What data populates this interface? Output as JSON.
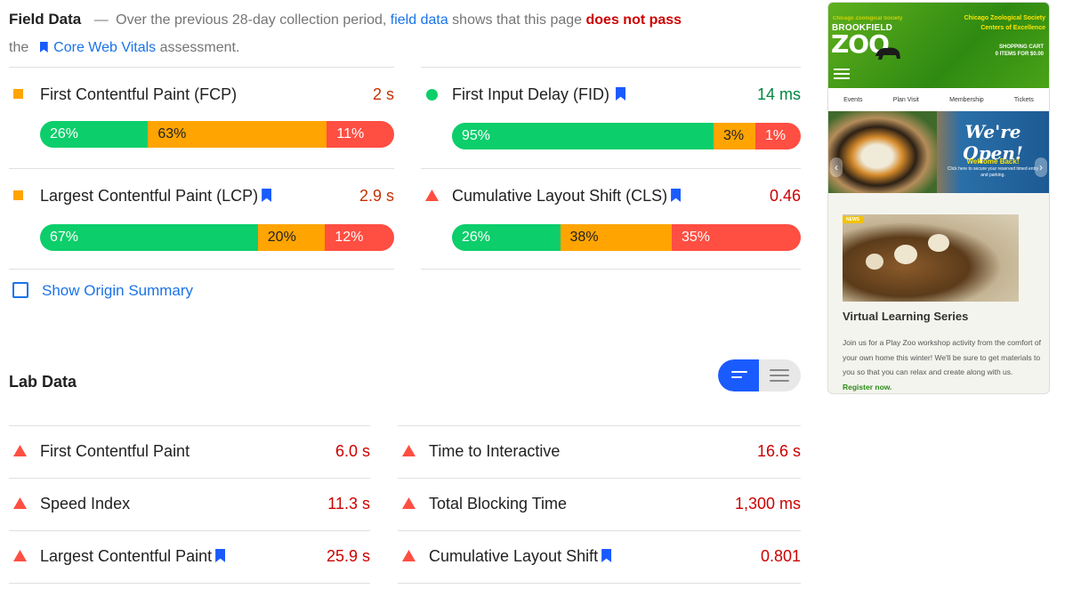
{
  "field": {
    "heading": "Field Data",
    "dash": "—",
    "intro_1": "Over the previous 28-day collection period,",
    "link_field_data": "field data",
    "intro_2": "shows that this page",
    "does_not_pass": "does not pass",
    "intro_3": "the",
    "link_cwv": "Core Web Vitals",
    "intro_4": "assessment.",
    "metrics": [
      {
        "title": "First Contentful Paint (FCP)",
        "value": "2 s",
        "rating": "average",
        "value_color": "#c33300",
        "bookmark": false,
        "bar": [
          {
            "label": "26%",
            "pct": 26
          },
          {
            "label": "63%",
            "pct": 63
          },
          {
            "label": "11%",
            "pct": 11
          }
        ]
      },
      {
        "title": "First Input Delay (FID)",
        "value": "14 ms",
        "rating": "good",
        "value_color": "#018642",
        "bookmark": true,
        "bar": [
          {
            "label": "95%",
            "pct": 95
          },
          {
            "label": "3%",
            "pct": 3
          },
          {
            "label": "1%",
            "pct": 1
          }
        ]
      },
      {
        "title": "Largest Contentful Paint (LCP)",
        "value": "2.9 s",
        "rating": "average",
        "value_color": "#c33300",
        "bookmark": true,
        "bar": [
          {
            "label": "67%",
            "pct": 67
          },
          {
            "label": "20%",
            "pct": 20
          },
          {
            "label": "12%",
            "pct": 12
          }
        ]
      },
      {
        "title": "Cumulative Layout Shift (CLS)",
        "value": "0.46",
        "rating": "poor",
        "value_color": "#cc0000",
        "bookmark": true,
        "bar": [
          {
            "label": "26%",
            "pct": 26
          },
          {
            "label": "38%",
            "pct": 38
          },
          {
            "label": "35%",
            "pct": 35
          }
        ]
      }
    ],
    "origin_label": "Show Origin Summary"
  },
  "lab": {
    "heading": "Lab Data",
    "metrics": [
      {
        "title": "First Contentful Paint",
        "value": "6.0 s",
        "bookmark": false
      },
      {
        "title": "Time to Interactive",
        "value": "16.6 s",
        "bookmark": false
      },
      {
        "title": "Speed Index",
        "value": "11.3 s",
        "bookmark": false
      },
      {
        "title": "Total Blocking Time",
        "value": "1,300 ms",
        "bookmark": false
      },
      {
        "title": "Largest Contentful Paint",
        "value": "25.9 s",
        "bookmark": true
      },
      {
        "title": "Cumulative Layout Shift",
        "value": "0.801",
        "bookmark": true
      }
    ]
  },
  "preview": {
    "brand_small": "Chicago Zoological Society",
    "brand_top": "BROOKFIELD",
    "brand_big": "ZOO",
    "society_1": "Chicago Zoological Society",
    "society_2": "Centers of Excellence",
    "cart_1": "SHOPPING CART",
    "cart_2": "0 ITEMS FOR $0.00",
    "nav": [
      "Events",
      "Plan Visit",
      "Membership",
      "Tickets"
    ],
    "banner_title": "We're Open!",
    "banner_welcome": "Welcome Back!",
    "banner_sub": "Click here to secure your reserved timed entry and parking.",
    "news_tag": "NEWS",
    "card_title": "Virtual Learning Series",
    "card_text": "Join us for a Play Zoo workshop activity from the comfort of your own home this winter! We'll be sure to get materials to you so that you can relax and create along with us.",
    "card_link": "Register now."
  },
  "colors": {
    "good": "#0cce6b",
    "average": "#ffa400",
    "poor": "#ff4e42",
    "link": "#1a73e8",
    "fail_text": "#cc0000",
    "toggle_on": "#1a5bff"
  }
}
